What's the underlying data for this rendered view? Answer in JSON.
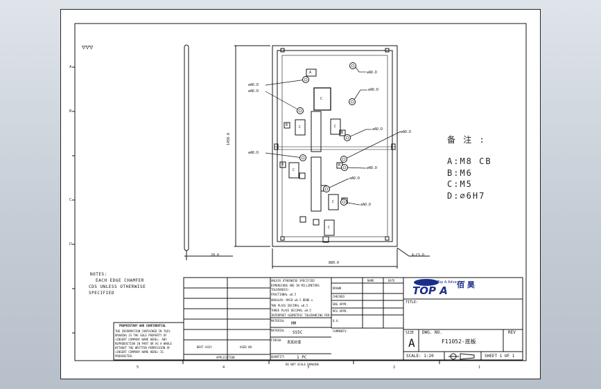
{
  "window": {
    "background": "#c9d0d8",
    "sheet_color": "#ffffff",
    "line_color": "#111111"
  },
  "border_marks": {
    "left": [
      "A",
      "B",
      "C",
      "D"
    ],
    "bottom": [
      "5",
      "4",
      "3",
      "2",
      "1"
    ]
  },
  "surface_symbol": "▽▽▽",
  "dimensions": {
    "height": "1450.0",
    "width": "880.0",
    "thickness": "20.0",
    "section": "A-CS.D",
    "hole_label": "∅AD.D"
  },
  "hole_letters": {
    "c": "C",
    "a": "A",
    "b": "B"
  },
  "legend": {
    "title": "备 注 :",
    "items": [
      "A:M8 CB",
      "B:M6",
      "C:M5",
      "D:∅6H7"
    ]
  },
  "notes": {
    "heading": "NOTES:",
    "line1": "EACH EDGE CHAMFER",
    "line2": "CDS UNLESS OTHERWISE",
    "line3": "SPECIFIED"
  },
  "proprietary": {
    "title": "PROPRIETARY AND CONFIDENTIAL",
    "lines": [
      "THE INFORMATION CONTAINED IN THIS",
      "DRAWING IS THE SOLE PROPERTY OF",
      "<INSERT COMPANY NAME HERE>. ANY",
      "REPRODUCTION IN PART OR AS A WHOLE",
      "WITHOUT THE WRITTEN PERMISSION OF",
      "<INSERT COMPANY NAME HERE> IS",
      "PROHIBITED."
    ]
  },
  "title_block": {
    "unless": "UNLESS OTHERWISE SPECIFIED",
    "dims_in": "DIMENSIONS ARE IN MILLIMETERS",
    "tolerances": "TOLERANCES:",
    "frac": "FRACTIONAL ±0.5",
    "angular": "ANGULAR: MACH ±0.5 BEND ±",
    "two_place": "TWO PLACE DECIMAL ±0.5",
    "three_place": "THREE PLACE DECIMAL ±0.5",
    "interpret": "INTERPRET GEOMETRIC TOLERANCING PER:",
    "material_lbl": "MATERIAL",
    "material": "SS5C",
    "finish_lbl": "FINISH",
    "finish": "发黑处理",
    "quantity_lbl": "QUANTITY",
    "quantity": "1 PC",
    "mm": "MM",
    "name": "NAME",
    "date": "DATE",
    "drawn": "DRAWN",
    "checked": "CHECKED",
    "eng_appr": "ENG APPR.",
    "mfg_appr": "MFG APPR.",
    "qa": "Q.A.",
    "comments": "COMMENTS:",
    "next_assy": "NEXT ASSY",
    "used_on": "USED ON",
    "application": "APPLICATION",
    "do_not_scale": "DO NOT SCALE DRAWING",
    "title_lbl": "TITLE:",
    "size_lbl": "SIZE",
    "size": "A",
    "dwg_no_lbl": "DWG. NO.",
    "dwg_no": "F11052-底板",
    "rev_lbl": "REV",
    "scale": "SCALE: 1:20",
    "sheet": "SHEET 1 OF 1"
  },
  "logo": {
    "small": "Top A Advanced",
    "main": "TOP A",
    "cn": "佰 昊",
    "color": "#1a2e8a"
  }
}
